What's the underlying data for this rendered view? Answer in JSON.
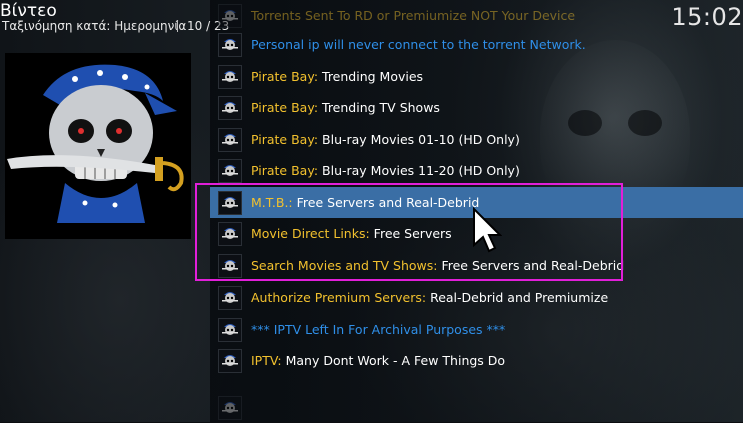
{
  "header": {
    "title": "Βίντεο",
    "sort_label": "Ταξινόμηση κατά: Ημερομηνία",
    "count": "10 / 23",
    "clock": "15:02"
  },
  "colors": {
    "highlight": "#f2c12e",
    "info": "#2f8fe8",
    "selected_bg": "#3a6ea5",
    "annotation_box": "#e11fd9"
  },
  "items": [
    {
      "label": "Torrents Sent To RD or Premiumize NOT Your Device",
      "rest": "",
      "style": "faded"
    },
    {
      "label": "Personal ip will never connect to the torrent Network.",
      "rest": "",
      "style": "blue"
    },
    {
      "label": "Pirate Bay:",
      "rest": " Trending Movies",
      "style": "normal"
    },
    {
      "label": "Pirate Bay:",
      "rest": " Trending TV Shows",
      "style": "normal"
    },
    {
      "label": "Pirate Bay:",
      "rest": " Blu-ray Movies 01-10 (HD Only)",
      "style": "normal"
    },
    {
      "label": "Pirate Bay:",
      "rest": " Blu-ray Movies 11-20 (HD Only)",
      "style": "normal"
    },
    {
      "label": "M.T.B.:",
      "rest": " Free Servers and Real-Debrid",
      "style": "selected"
    },
    {
      "label": "Movie Direct Links:",
      "rest": " Free Servers",
      "style": "normal"
    },
    {
      "label": "Search Movies and TV Shows:",
      "rest": " Free Servers and Real-Debrid",
      "style": "normal"
    },
    {
      "label": "Authorize Premium Servers:",
      "rest": " Real-Debrid and Premiumize",
      "style": "normal"
    },
    {
      "label": "*** IPTV Left In For Archival Purposes ***",
      "rest": "",
      "style": "blue"
    },
    {
      "label": "IPTV:",
      "rest": " Many Dont Work - A Few Things Do",
      "style": "normal"
    },
    {
      "label": "",
      "rest": "",
      "style": "faded"
    }
  ]
}
